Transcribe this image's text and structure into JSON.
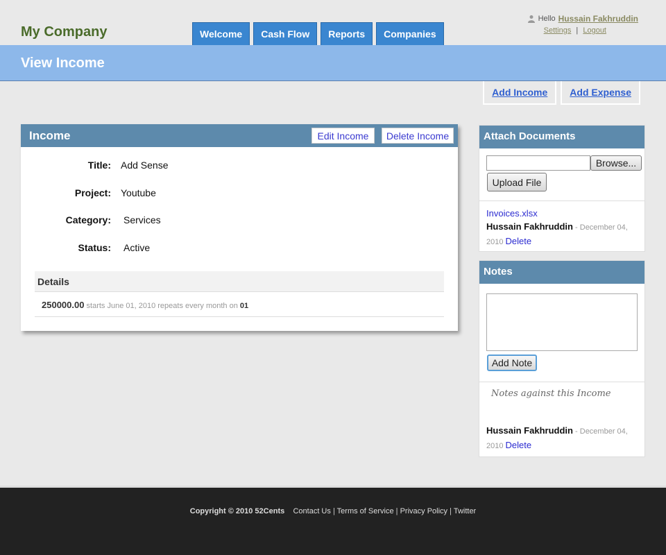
{
  "brand": "My Company",
  "tabs": [
    "Welcome",
    "Cash Flow",
    "Reports",
    "Companies"
  ],
  "user": {
    "hello": "Hello",
    "name": "Hussain Fakhruddin",
    "settings": "Settings",
    "separator": "|",
    "logout": "Logout"
  },
  "page_title": "View Income",
  "actions": {
    "add_income": "Add Income",
    "add_expense": "Add Expense"
  },
  "income": {
    "header": "Income",
    "edit_label": "Edit Income",
    "delete_label": "Delete Income",
    "fields": [
      {
        "label": "Title:",
        "value": "Add Sense"
      },
      {
        "label": "Project:",
        "value": "Youtube"
      },
      {
        "label": "Category:",
        "value": "Services"
      },
      {
        "label": "Status:",
        "value": "Active"
      }
    ],
    "details": {
      "header": "Details",
      "amount": "250000.00",
      "schedule": "starts June 01, 2010 repeats every month on",
      "repeat_day": "01"
    }
  },
  "attach": {
    "header": "Attach Documents",
    "browse_label": "Browse...",
    "upload_label": "Upload File",
    "file_name": "Invoices.xlsx",
    "author": "Hussain Fakhruddin",
    "date": "- December 04, 2010",
    "delete_label": "Delete"
  },
  "notes": {
    "header": "Notes",
    "add_label": "Add Note",
    "caption": "Notes against this Income",
    "author": "Hussain Fakhruddin",
    "date": "- December 04, 2010",
    "delete_label": "Delete"
  },
  "footer": {
    "copyright": "Copyright © 2010 52Cents",
    "links": [
      "Contact Us",
      "Terms of Service",
      "Privacy Policy",
      "Twitter"
    ],
    "separator": "|"
  },
  "icons": {
    "user": "user-icon"
  },
  "colors": {
    "tab_bg": "#3a86d0",
    "band_bg": "#8db8ea",
    "panel_header": "#5d8aac",
    "brand": "#4a6b2a",
    "link": "#2f5fd0",
    "footer_bg": "#222222"
  }
}
